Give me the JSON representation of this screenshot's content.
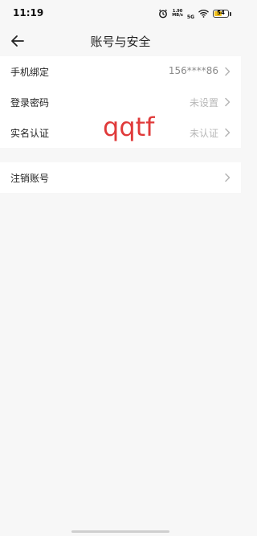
{
  "status_bar": {
    "time": "11:19",
    "net_speed_value": "1.90",
    "net_speed_unit": "MB/s",
    "network_type": "5G",
    "battery_level": "54",
    "battery_fraction": 0.54,
    "battery_color": "#f3c21a",
    "icons": [
      "alarm-icon",
      "signal-icon",
      "wifi-icon",
      "battery-icon"
    ]
  },
  "header": {
    "title": "账号与安全",
    "back_icon": "arrow-left-icon"
  },
  "settings": {
    "items": [
      {
        "label": "手机绑定",
        "value": "156****86"
      },
      {
        "label": "登录密码",
        "value": "未设置"
      },
      {
        "label": "实名认证",
        "value": "未认证"
      }
    ]
  },
  "danger": {
    "items": [
      {
        "label": "注销账号",
        "value": ""
      }
    ]
  },
  "watermark": {
    "text": "qqtf",
    "color": "#e03a3a"
  }
}
